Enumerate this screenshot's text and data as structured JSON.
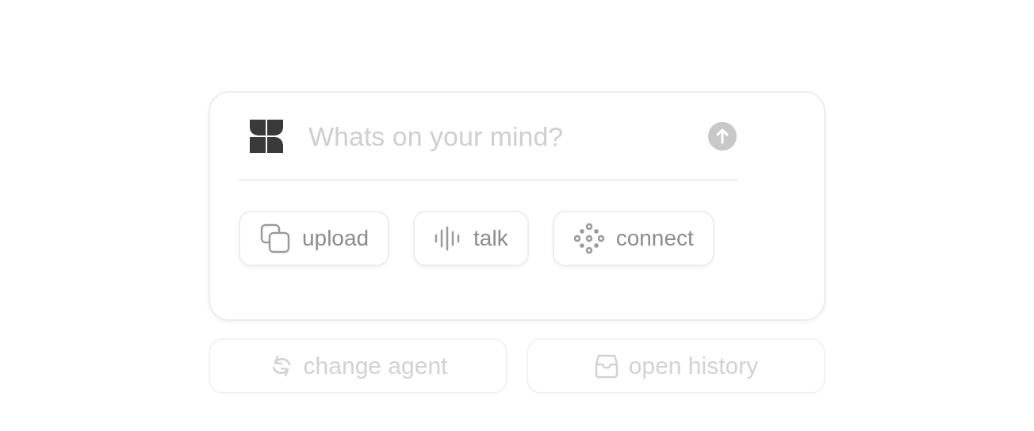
{
  "prompt": {
    "placeholder": "Whats on your mind?"
  },
  "tools": [
    {
      "kind": "upload",
      "label": "upload"
    },
    {
      "kind": "talk",
      "label": "talk"
    },
    {
      "kind": "connect",
      "label": "connect"
    }
  ],
  "actions": [
    {
      "kind": "change",
      "label": "change agent",
      "disabled": true
    },
    {
      "kind": "history",
      "label": "open history",
      "disabled": true
    }
  ]
}
